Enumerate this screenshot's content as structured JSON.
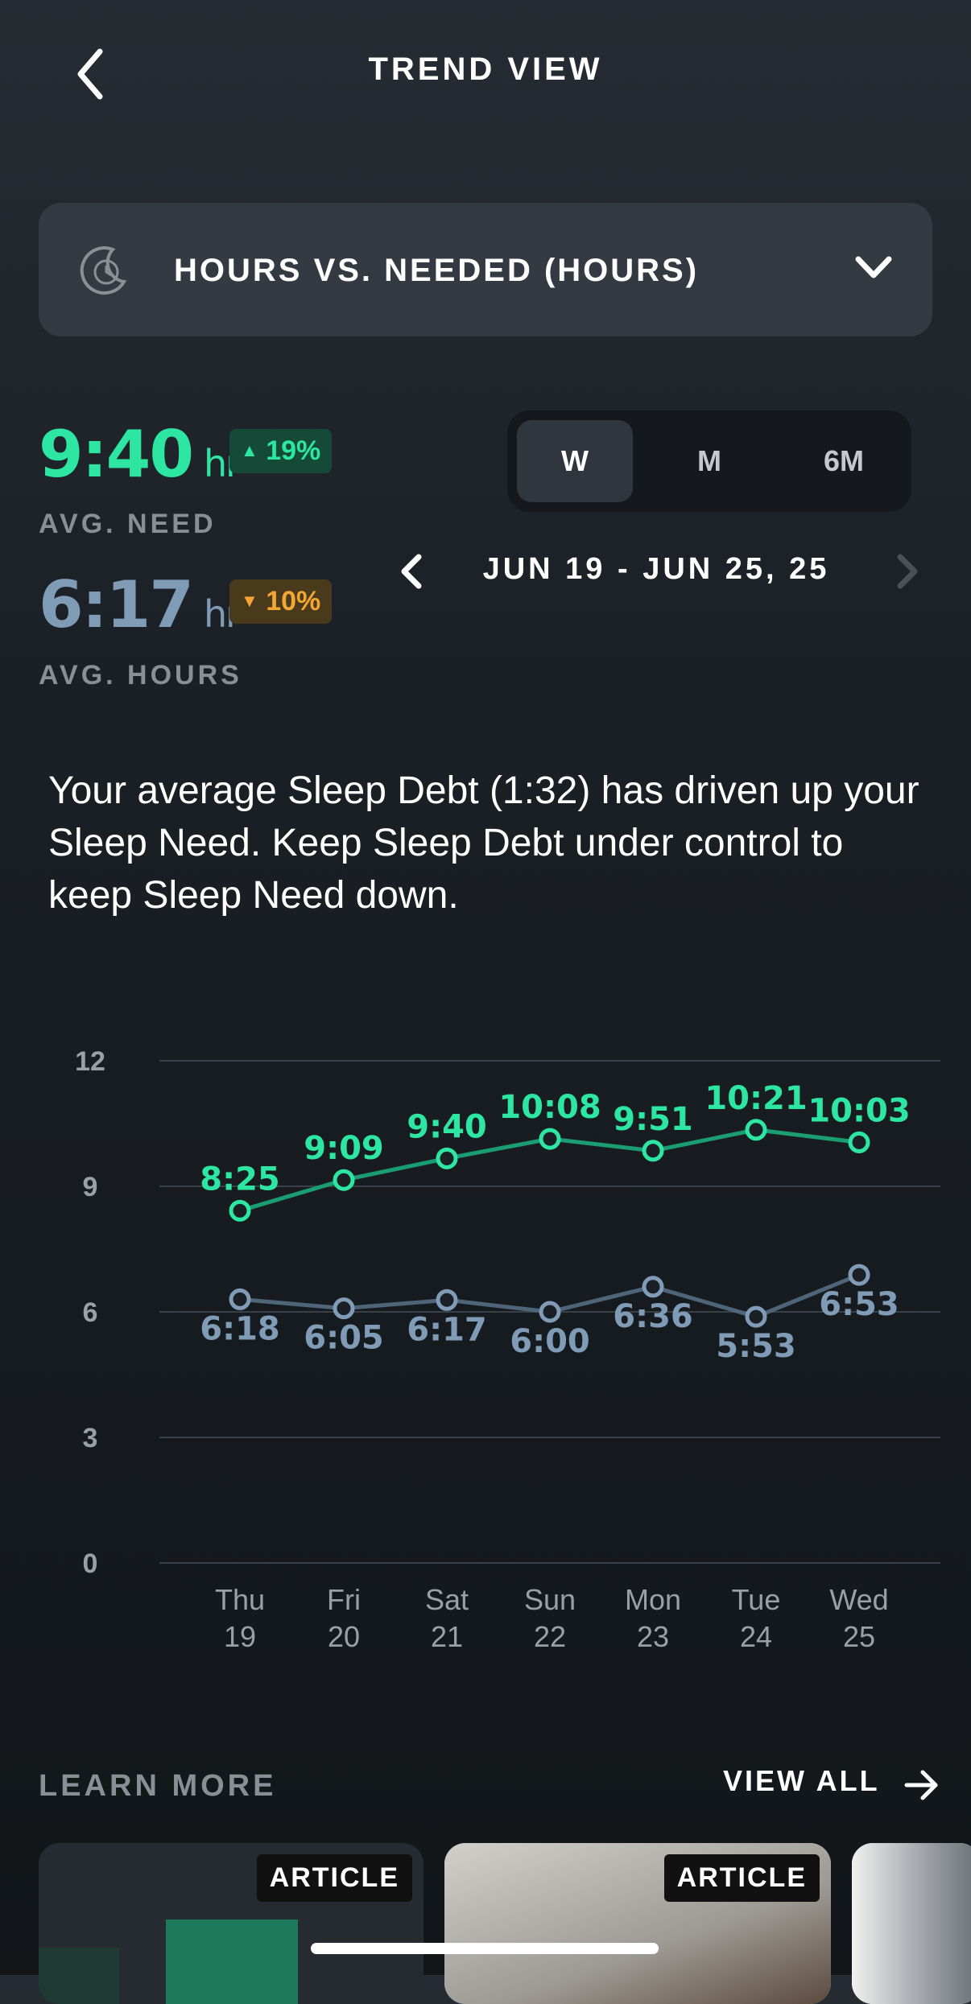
{
  "header": {
    "title": "TREND VIEW"
  },
  "metric_selector": {
    "label": "HOURS VS. NEEDED (HOURS)"
  },
  "stats": {
    "need": {
      "value": "9:40",
      "unit": "hr",
      "change": "19%",
      "label": "AVG. NEED"
    },
    "hours": {
      "value": "6:17",
      "unit": "hr",
      "change": "10%",
      "label": "AVG. HOURS"
    }
  },
  "period_toggle": {
    "options": [
      "W",
      "M",
      "6M"
    ],
    "selected": "W"
  },
  "date_range": "JUN 19 - JUN 25, 25",
  "insight": "Your average Sleep Debt (1:32) has driven up your Sleep Need. Keep Sleep Debt under control to keep Sleep Need down.",
  "colors": {
    "need": "#2ce6a1",
    "hours": "#7f9bb6",
    "up_badge_bg": "#154a39",
    "down_badge_bg": "#4a3a1c",
    "down_text": "#f4a634"
  },
  "chart_data": {
    "type": "line",
    "categories": [
      "Thu 19",
      "Fri 20",
      "Sat 21",
      "Sun 22",
      "Mon 23",
      "Tue 24",
      "Wed 25"
    ],
    "x_day": [
      "Thu",
      "Fri",
      "Sat",
      "Sun",
      "Mon",
      "Tue",
      "Wed"
    ],
    "x_date": [
      "19",
      "20",
      "21",
      "22",
      "23",
      "24",
      "25"
    ],
    "y_ticks": [
      "12",
      "9",
      "6",
      "3",
      "0"
    ],
    "ylim": [
      0,
      12
    ],
    "grid": true,
    "series": [
      {
        "color": "#2ce6a1",
        "values": [
          8.4167,
          9.15,
          9.6667,
          10.1333,
          9.85,
          10.35,
          10.05
        ],
        "labels": [
          "8:25",
          "9:09",
          "9:40",
          "10:08",
          "9:51",
          "10:21",
          "10:03"
        ]
      },
      {
        "color": "#7f9bb6",
        "values": [
          6.3,
          6.0833,
          6.2833,
          6.0,
          6.6,
          5.8833,
          6.8833
        ],
        "labels": [
          "6:18",
          "6:05",
          "6:17",
          "6:00",
          "6:36",
          "5:53",
          "6:53"
        ]
      }
    ]
  },
  "learn_more": {
    "title": "LEARN MORE",
    "view_all": "VIEW ALL",
    "cards": [
      {
        "tag": "ARTICLE"
      },
      {
        "tag": "ARTICLE"
      },
      {
        "tag": ""
      }
    ]
  }
}
